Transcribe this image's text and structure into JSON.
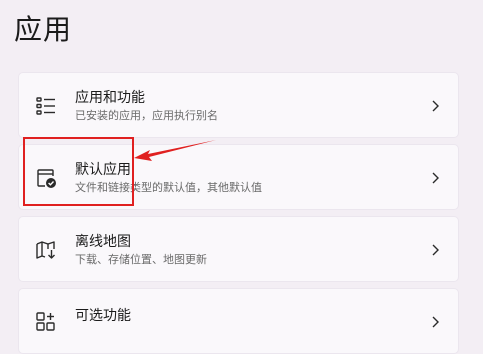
{
  "page": {
    "title": "应用"
  },
  "items": [
    {
      "title": "应用和功能",
      "subtitle": "已安装的应用，应用执行别名",
      "icon": "apps-list-icon"
    },
    {
      "title": "默认应用",
      "subtitle": "文件和链接类型的默认值，其他默认值",
      "icon": "default-apps-icon"
    },
    {
      "title": "离线地图",
      "subtitle": "下载、存储位置、地图更新",
      "icon": "offline-maps-icon"
    },
    {
      "title": "可选功能",
      "subtitle": "",
      "icon": "optional-features-icon"
    }
  ],
  "colors": {
    "background": "#f3eef4",
    "card": "#faf8fb",
    "annotation": "#e02020"
  }
}
